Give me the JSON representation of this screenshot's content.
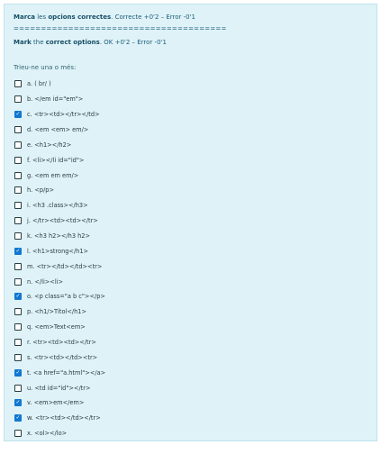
{
  "question": {
    "line1": [
      {
        "text": "Marca",
        "bold": true
      },
      {
        "text": " les ",
        "bold": false
      },
      {
        "text": "opcions correctes",
        "bold": true
      },
      {
        "text": ". Correcte +0'2 – Error -0'1",
        "bold": false
      }
    ],
    "separator": "=======================================",
    "line2": [
      {
        "text": "Mark",
        "bold": true
      },
      {
        "text": " the ",
        "bold": false
      },
      {
        "text": "correct options",
        "bold": true
      },
      {
        "text": ". OK +0'2 – Error -0'1",
        "bold": false
      }
    ]
  },
  "prompt": "Trieu-ne una o més:",
  "options": [
    {
      "label": "a. ( br/ )",
      "checked": false
    },
    {
      "label": "b. </em id=\"em\">",
      "checked": false
    },
    {
      "label": "c. <tr><td></tr></td>",
      "checked": true
    },
    {
      "label": "d. <em <em> em/>",
      "checked": false
    },
    {
      "label": "e. <h1></h2>",
      "checked": false
    },
    {
      "label": "f. <li></li id=\"id\">",
      "checked": false
    },
    {
      "label": "g. <em em em/>",
      "checked": false
    },
    {
      "label": "h. <p/p>",
      "checked": false
    },
    {
      "label": "i. <h3 .class></h3>",
      "checked": false
    },
    {
      "label": "j. </tr><td><td></tr>",
      "checked": false
    },
    {
      "label": "k. <h3 h2></h3 h2>",
      "checked": false
    },
    {
      "label": "l. <h1>strong</h1>",
      "checked": true
    },
    {
      "label": "m. <tr></td></td><tr>",
      "checked": false
    },
    {
      "label": "n. </li><li>",
      "checked": false
    },
    {
      "label": "o. <p class=\"a b c\"></p>",
      "checked": true
    },
    {
      "label": "p. <h1/>Títol</h1>",
      "checked": false
    },
    {
      "label": "q. <em>Text<em>",
      "checked": false
    },
    {
      "label": "r. <tr><td><td></tr>",
      "checked": false
    },
    {
      "label": "s. <tr><td></td><tr>",
      "checked": false
    },
    {
      "label": "t. <a href=\"a.html\"></a>",
      "checked": true
    },
    {
      "label": "u. <td id=\"id\"></tr>",
      "checked": false
    },
    {
      "label": "v. <em>em</em>",
      "checked": true
    },
    {
      "label": "w. <tr><td></td></tr>",
      "checked": true
    },
    {
      "label": "x. <ol></lo>",
      "checked": false
    }
  ],
  "colors": {
    "panel_background": "#def2f8",
    "question_text": "#1c5d78",
    "checkbox_checked": "#1177d1"
  }
}
